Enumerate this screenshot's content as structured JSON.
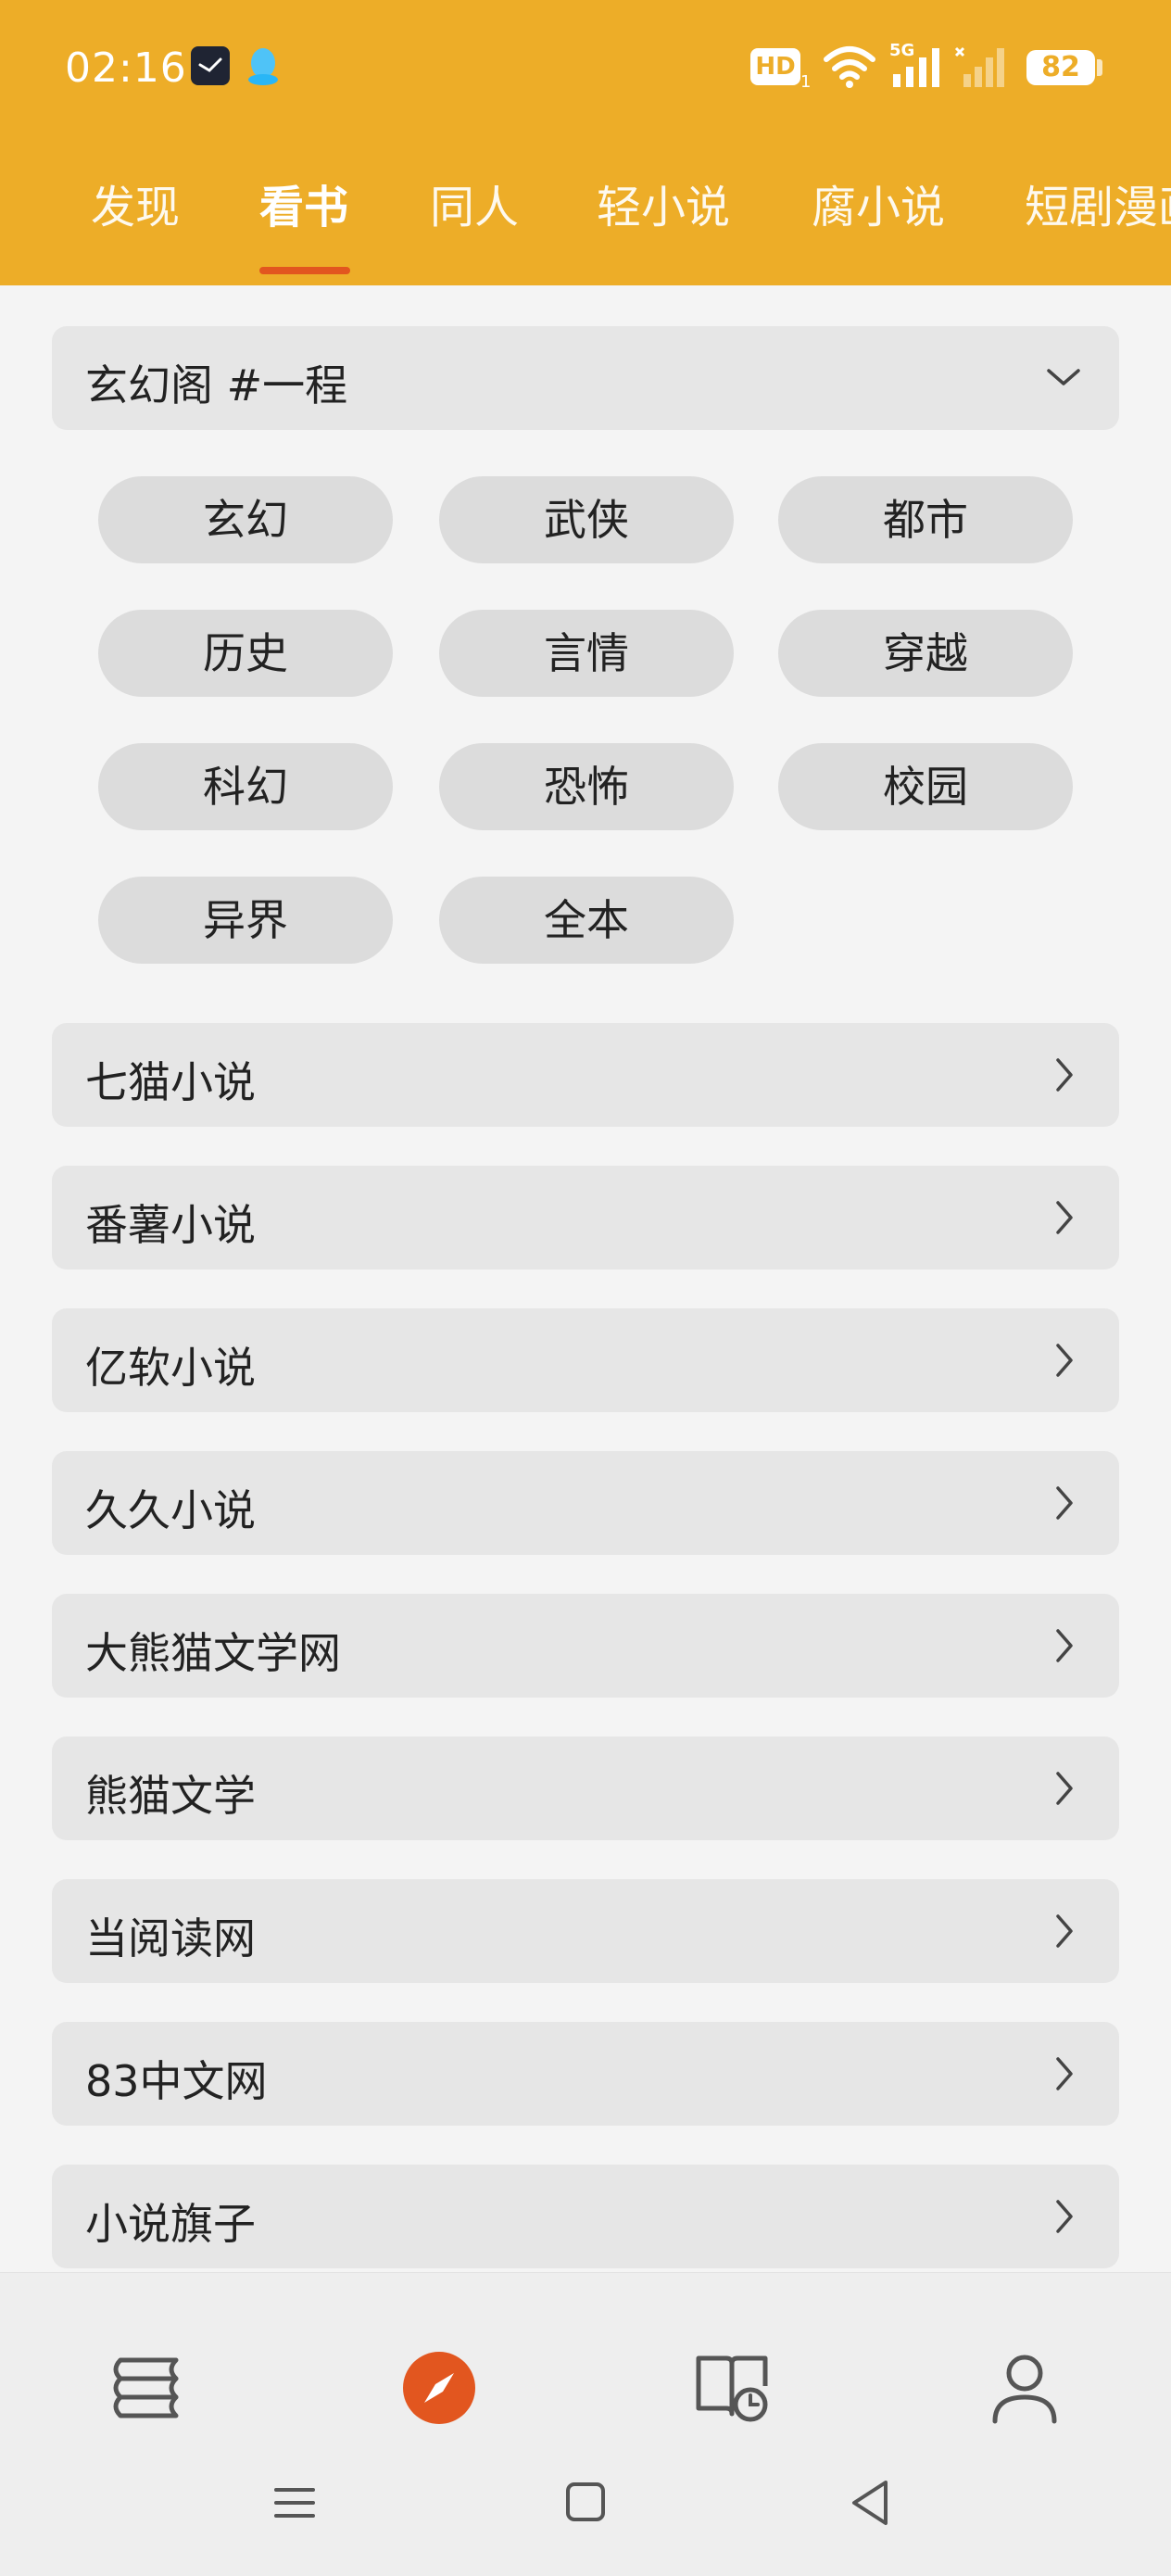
{
  "status_bar": {
    "time": "02:16",
    "hd_label": "HD",
    "hd_sub": "1",
    "network_label": "5G",
    "battery": "82"
  },
  "tabs": [
    {
      "label": "发现",
      "active": false
    },
    {
      "label": "看书",
      "active": true
    },
    {
      "label": "同人",
      "active": false
    },
    {
      "label": "轻小说",
      "active": false
    },
    {
      "label": "腐小说",
      "active": false
    },
    {
      "label": "短剧漫画",
      "active": false
    }
  ],
  "expanded_section": {
    "title": "玄幻阁 #一程",
    "icon": "chevron-down-icon"
  },
  "categories": [
    "玄幻",
    "武侠",
    "都市",
    "历史",
    "言情",
    "穿越",
    "科幻",
    "恐怖",
    "校园",
    "异界",
    "全本"
  ],
  "sources": [
    {
      "label": "七猫小说"
    },
    {
      "label": "番薯小说"
    },
    {
      "label": "亿软小说"
    },
    {
      "label": "久久小说"
    },
    {
      "label": "大熊猫文学网"
    },
    {
      "label": "熊猫文学"
    },
    {
      "label": "当阅读网"
    },
    {
      "label": "83中文网"
    },
    {
      "label": "小说旗子"
    }
  ],
  "bottom_nav": [
    {
      "icon": "bookshelf-icon",
      "active": false
    },
    {
      "icon": "compass-icon",
      "active": true
    },
    {
      "icon": "reading-history-icon",
      "active": false
    },
    {
      "icon": "profile-icon",
      "active": false
    }
  ],
  "colors": {
    "header": "#edad28",
    "accent": "#e2561f",
    "background": "#f4f4f4",
    "card": "#e6e6e6",
    "chip": "#dcdcdc"
  }
}
